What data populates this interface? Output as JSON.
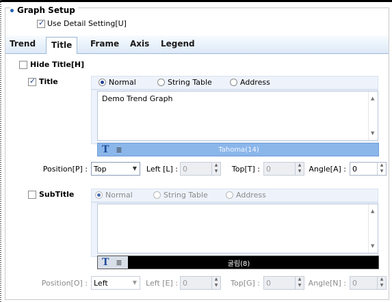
{
  "group": {
    "title": "Graph Setup",
    "use_detail_label": "Use Detail Setting[U]",
    "use_detail_checked": true
  },
  "tabs": [
    {
      "label": "Trend",
      "active": false
    },
    {
      "label": "Title",
      "active": true
    },
    {
      "label": "Frame",
      "active": false
    },
    {
      "label": "Axis",
      "active": false
    },
    {
      "label": "Legend",
      "active": false
    }
  ],
  "hide_title": {
    "label": "Hide Title[H]",
    "checked": false
  },
  "title_section": {
    "label": "Title",
    "checked": true,
    "options": [
      "Normal",
      "String Table",
      "Address"
    ],
    "selected": "Normal",
    "text": "Demo Trend Graph",
    "font_name": "Tahoma(14)",
    "position_label": "Position[P] :",
    "position_value": "Top",
    "left_label": "Left [L] :",
    "left_value": "0",
    "top_label": "Top[T] :",
    "top_value": "0",
    "angle_label": "Angle[A] :",
    "angle_value": "0"
  },
  "subtitle_section": {
    "label": "SubTitle",
    "checked": false,
    "options": [
      "Normal",
      "String Table",
      "Address"
    ],
    "selected": "Normal",
    "text": "",
    "font_name": "굴림(8)",
    "position_label": "Position[O] :",
    "position_value": "Left",
    "left_label": "Left [E] :",
    "left_value": "0",
    "top_label": "Top[G] :",
    "top_value": "0",
    "angle_label": "Angle[N] :",
    "angle_value": "0"
  },
  "colors": {
    "accent": "#1f5fb3",
    "title_fontbar": "#8bb6ea",
    "subtitle_fontbar": "#000000",
    "tab_border": "#9fb8d8"
  },
  "icons": [
    "bullet-icon",
    "font-t-icon",
    "align-icon",
    "chevron-down-icon",
    "spin-up-icon",
    "spin-down-icon"
  ]
}
